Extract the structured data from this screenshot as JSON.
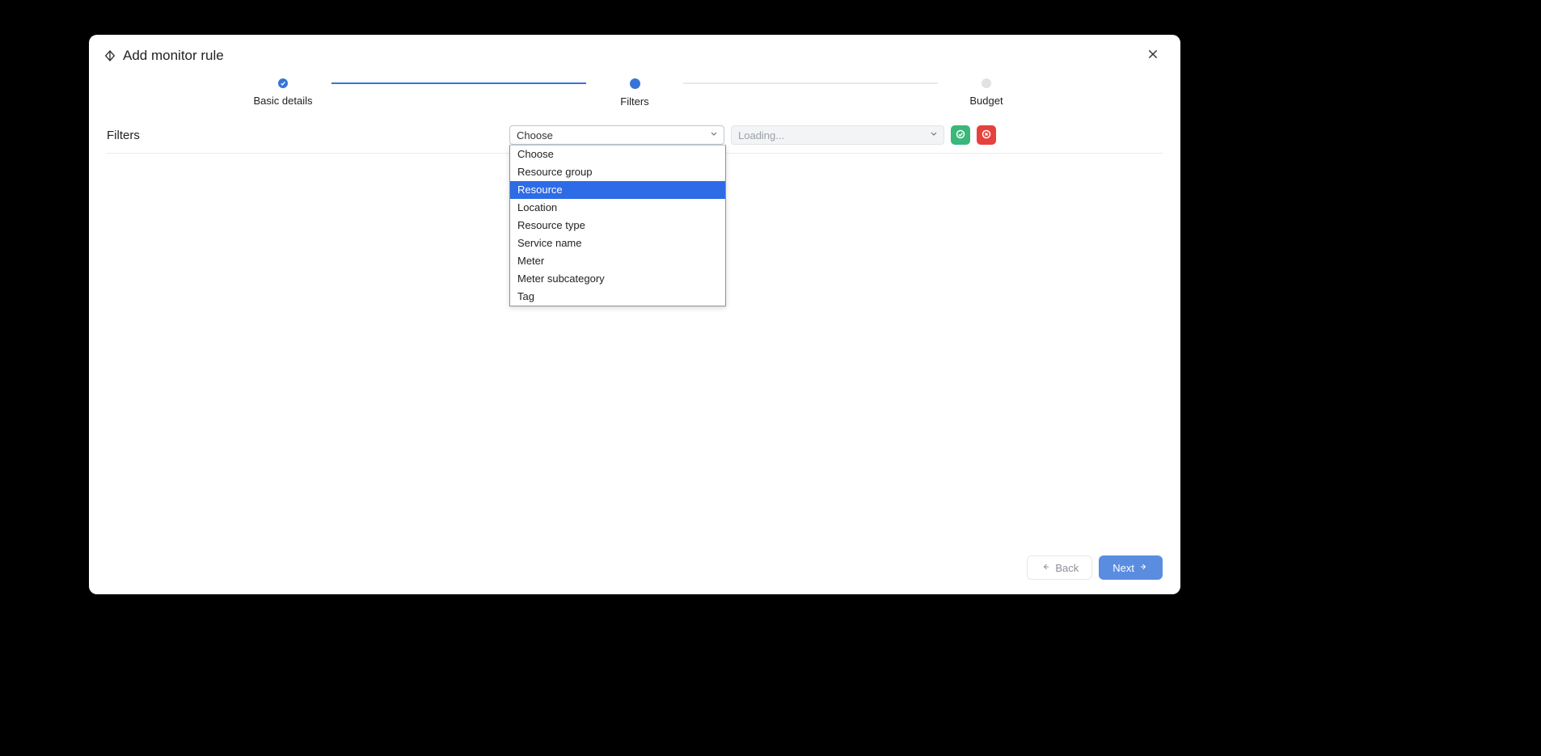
{
  "modal": {
    "title": "Add monitor rule"
  },
  "stepper": {
    "steps": [
      {
        "label": "Basic details",
        "state": "done"
      },
      {
        "label": "Filters",
        "state": "current"
      },
      {
        "label": "Budget",
        "state": "upcoming"
      }
    ]
  },
  "section": {
    "label": "Filters"
  },
  "filter_select": {
    "value": "Choose",
    "options": [
      "Choose",
      "Resource group",
      "Resource",
      "Location",
      "Resource type",
      "Service name",
      "Meter",
      "Meter subcategory",
      "Tag"
    ],
    "highlighted_index": 2
  },
  "value_select": {
    "placeholder": "Loading..."
  },
  "footer": {
    "back": "Back",
    "next": "Next"
  }
}
